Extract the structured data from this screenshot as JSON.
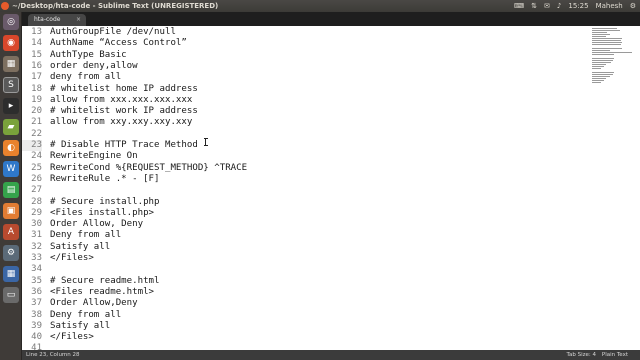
{
  "window": {
    "title": "~/Desktop/hta-code - Sublime Text (UNREGISTERED)"
  },
  "indicators": {
    "time": "15:25",
    "user": "Mahesh"
  },
  "tab": {
    "label": "hta-code",
    "close": "×"
  },
  "editor": {
    "lines": [
      {
        "n": "13",
        "text": "AuthGroupFile /dev/null"
      },
      {
        "n": "14",
        "text": "AuthName “Access Control”"
      },
      {
        "n": "15",
        "text": "AuthType Basic"
      },
      {
        "n": "16",
        "text": "order deny,allow"
      },
      {
        "n": "17",
        "text": "deny from all"
      },
      {
        "n": "18",
        "text": "# whitelist home IP address"
      },
      {
        "n": "19",
        "text": "allow from xxx.xxx.xxx.xxx"
      },
      {
        "n": "20",
        "text": "# whitelist work IP address"
      },
      {
        "n": "21",
        "text": "allow from xxy.xxy.xxy.xxy"
      },
      {
        "n": "22",
        "text": ""
      },
      {
        "n": "23",
        "text": "# Disable HTTP Trace Method"
      },
      {
        "n": "24",
        "text": "RewriteEngine On"
      },
      {
        "n": "25",
        "text": "RewriteCond %{REQUEST_METHOD} ^TRACE"
      },
      {
        "n": "26",
        "text": "RewriteRule .* - [F]"
      },
      {
        "n": "27",
        "text": ""
      },
      {
        "n": "28",
        "text": "# Secure install.php"
      },
      {
        "n": "29",
        "text": "<Files install.php>"
      },
      {
        "n": "30",
        "text": "Order Allow, Deny"
      },
      {
        "n": "31",
        "text": "Deny from all"
      },
      {
        "n": "32",
        "text": "Satisfy all"
      },
      {
        "n": "33",
        "text": "</Files>"
      },
      {
        "n": "34",
        "text": ""
      },
      {
        "n": "35",
        "text": "# Secure readme.html"
      },
      {
        "n": "36",
        "text": "<Files readme.html>"
      },
      {
        "n": "37",
        "text": "Order Allow,Deny"
      },
      {
        "n": "38",
        "text": "Deny from all"
      },
      {
        "n": "39",
        "text": "Satisfy all"
      },
      {
        "n": "40",
        "text": "</Files>"
      },
      {
        "n": "41",
        "text": ""
      }
    ]
  },
  "status": {
    "position": "Line 23, Column 28",
    "tab_size": "Tab Size: 4",
    "syntax": "Plain Text"
  },
  "colors": {
    "accent_close": "#e85b2b",
    "launcher_bg": "#3f3b38",
    "editor_bg": "#ffffff"
  },
  "launcher_icons": [
    "dash-icon",
    "chrome-icon",
    "files-icon",
    "sublime-text-icon",
    "terminal-icon",
    "folder-icon",
    "firefox-icon",
    "writer-icon",
    "calc-icon",
    "impress-icon",
    "software-center-icon",
    "settings-icon",
    "workspaces-icon",
    "trash-icon"
  ]
}
